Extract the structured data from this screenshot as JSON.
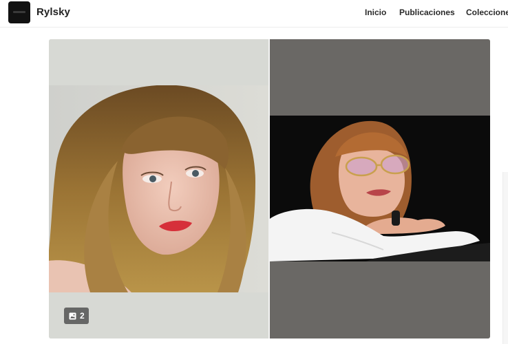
{
  "header": {
    "site_name": "Rylsky",
    "nav": {
      "inicio": "Inicio",
      "publicaciones": "Publicaciones",
      "colecciones": "Coleccione"
    }
  },
  "gallery": {
    "items": [
      {
        "image_count": "2",
        "badge_icon": "image-stack-icon"
      },
      {}
    ]
  },
  "colors": {
    "header_bg": "#ffffff",
    "text": "#222222",
    "tile_light_bg": "#d7d9d4",
    "tile_dark_bg": "#6a6865"
  }
}
